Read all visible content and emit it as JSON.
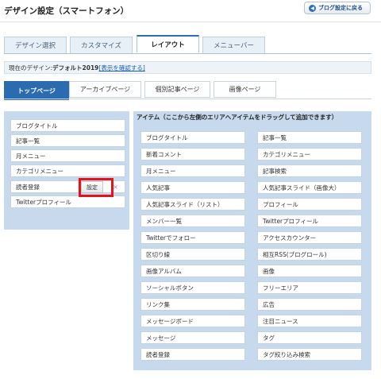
{
  "header": {
    "title": "デザイン設定（スマートフォン）",
    "back_button": "ブログ設定に戻る"
  },
  "main_tabs": [
    {
      "label": "デザイン選択",
      "active": false
    },
    {
      "label": "カスタマイズ",
      "active": false
    },
    {
      "label": "レイアウト",
      "active": true
    },
    {
      "label": "メニューバー",
      "active": false
    }
  ],
  "design_bar": {
    "prefix": "現在のデザイン: ",
    "design_name": "デフォルト2019",
    "link": "[表示を確認する]"
  },
  "sub_tabs": [
    {
      "label": "トップページ",
      "active": true
    },
    {
      "label": "アーカイブページ",
      "active": false
    },
    {
      "label": "個別記事ページ",
      "active": false
    },
    {
      "label": "画像ページ",
      "active": false
    }
  ],
  "left_panel": {
    "items": [
      "ブログタイトル",
      "記事一覧",
      "月メニュー",
      "カテゴリメニュー",
      "読者登録",
      "Twitterプロフィール"
    ],
    "settings_button": "設定",
    "delete_button": "×"
  },
  "right_panel": {
    "header": "アイテム（ここから左側のエリアへアイテムをドラッグして追加できます）",
    "items": [
      "ブログタイトル",
      "記事一覧",
      "新着コメント",
      "カテゴリメニュー",
      "月メニュー",
      "記事検索",
      "人気記事",
      "人気記事スライド（画像大）",
      "人気記事スライド（リスト）",
      "プロフィール",
      "メンバー一覧",
      "Twitterプロフィール",
      "Twitterでフォロー",
      "アクセスカウンター",
      "区切り線",
      "相互RSS(ブログロール)",
      "画像アルバム",
      "画像",
      "ソーシャルボタン",
      "フリーエリア",
      "リンク集",
      "広告",
      "メッセージボード",
      "注目ニュース",
      "メッセージ",
      "タグ",
      "読者登録",
      "タグ絞り込み検索"
    ]
  }
}
